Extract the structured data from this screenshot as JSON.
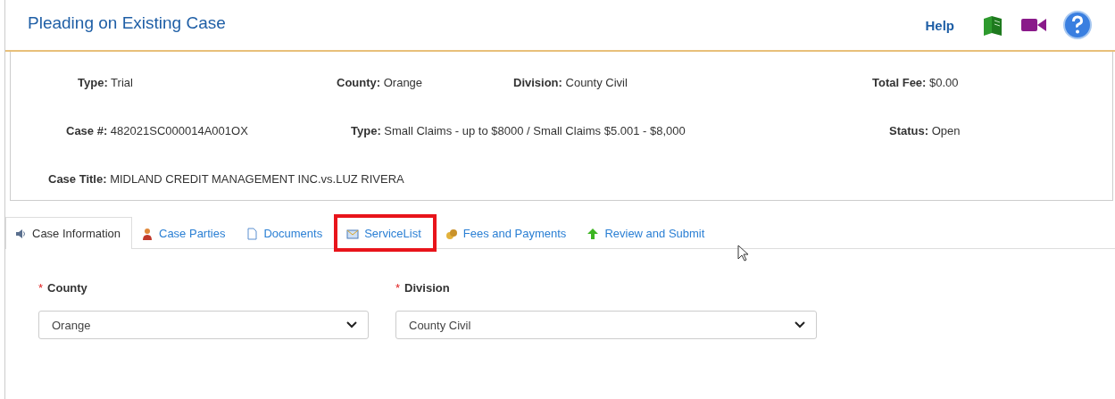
{
  "header": {
    "title": "Pleading on Existing Case",
    "help_label": "Help"
  },
  "case_summary": {
    "rows": [
      [
        {
          "label": "Type:",
          "value": "Trial"
        },
        {
          "label": "County:",
          "value": "Orange"
        },
        {
          "label": "Division:",
          "value": "County Civil"
        },
        {
          "label": "Total Fee:",
          "value": "$0.00"
        }
      ],
      [
        {
          "label": "Case #:",
          "value": "482021SC000014A001OX"
        },
        {
          "label": "Type:",
          "value": "Small Claims - up to $8000 / Small Claims $5.001 - $8,000"
        },
        "",
        {
          "label": "Status:",
          "value": "Open"
        }
      ],
      [
        {
          "label": "Case Title:",
          "value": "MIDLAND CREDIT MANAGEMENT INC.vs.LUZ RIVERA"
        }
      ]
    ]
  },
  "tabs": [
    {
      "label": "Case Information",
      "kind": "speaker",
      "selected": true,
      "highlighted": false
    },
    {
      "label": "Case Parties",
      "kind": "person",
      "selected": false,
      "highlighted": false
    },
    {
      "label": "Documents",
      "kind": "document",
      "selected": false,
      "highlighted": false
    },
    {
      "label": "ServiceList",
      "kind": "envelope",
      "selected": false,
      "highlighted": true
    },
    {
      "label": "Fees and Payments",
      "kind": "coins",
      "selected": false,
      "highlighted": false
    },
    {
      "label": "Review and Submit",
      "kind": "arrow",
      "selected": false,
      "highlighted": false
    }
  ],
  "form": {
    "fields": [
      {
        "label": "County",
        "required_mark": "*",
        "value": "Orange"
      },
      {
        "label": "Division",
        "required_mark": "*",
        "value": "County Civil"
      }
    ]
  }
}
